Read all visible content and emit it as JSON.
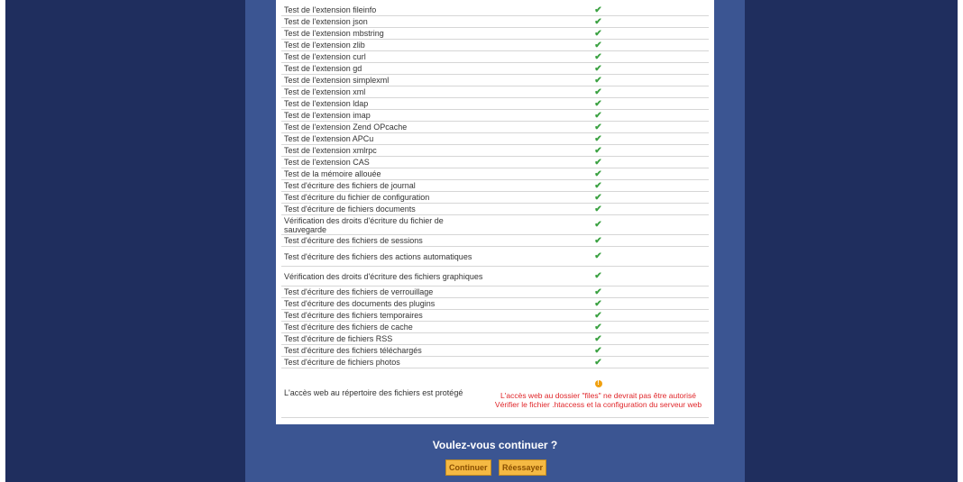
{
  "checks": [
    {
      "label": "Test de l'extension fileinfo",
      "status": "ok"
    },
    {
      "label": "Test de l'extension json",
      "status": "ok"
    },
    {
      "label": "Test de l'extension mbstring",
      "status": "ok"
    },
    {
      "label": "Test de l'extension zlib",
      "status": "ok"
    },
    {
      "label": "Test de l'extension curl",
      "status": "ok"
    },
    {
      "label": "Test de l'extension gd",
      "status": "ok"
    },
    {
      "label": "Test de l'extension simplexml",
      "status": "ok"
    },
    {
      "label": "Test de l'extension xml",
      "status": "ok"
    },
    {
      "label": "Test de l'extension ldap",
      "status": "ok"
    },
    {
      "label": "Test de l'extension imap",
      "status": "ok"
    },
    {
      "label": "Test de l'extension Zend OPcache",
      "status": "ok"
    },
    {
      "label": "Test de l'extension APCu",
      "status": "ok"
    },
    {
      "label": "Test de l'extension xmlrpc",
      "status": "ok"
    },
    {
      "label": "Test de l'extension CAS",
      "status": "ok"
    },
    {
      "label": "Test de la mémoire allouée",
      "status": "ok"
    },
    {
      "label": "Test d'écriture des fichiers de journal",
      "status": "ok"
    },
    {
      "label": "Test d'écriture du fichier de configuration",
      "status": "ok"
    },
    {
      "label": "Test d'écriture de fichiers documents",
      "status": "ok"
    },
    {
      "label": "Vérification des droits d'écriture du fichier de sauvegarde",
      "status": "ok"
    },
    {
      "label": "Test d'écriture des fichiers de sessions",
      "status": "ok"
    },
    {
      "label": "Test d'écriture des fichiers des actions automatiques",
      "status": "ok"
    },
    {
      "label": "Vérification des droits d'écriture des fichiers graphiques",
      "status": "ok"
    },
    {
      "label": "Test d'écriture des fichiers de verrouillage",
      "status": "ok"
    },
    {
      "label": "Test d'écriture des documents des plugins",
      "status": "ok"
    },
    {
      "label": "Test d'écriture des fichiers temporaires",
      "status": "ok"
    },
    {
      "label": "Test d'écriture des fichiers de cache",
      "status": "ok"
    },
    {
      "label": "Test d'écriture de fichiers RSS",
      "status": "ok"
    },
    {
      "label": "Test d'écriture des fichiers téléchargés",
      "status": "ok"
    },
    {
      "label": "Test d'écriture de fichiers photos",
      "status": "ok"
    }
  ],
  "warning_check": {
    "label": "L'accès web au répertoire des fichiers est protégé",
    "icon": "warning-icon",
    "message_line1": "L'accès web au dossier \"files\" ne devrait pas être autorisé",
    "message_line2": "Vérifier le fichier .htaccess et la configuration du serveur web"
  },
  "ok_icon": "check-icon",
  "ok_glyph": "✔",
  "warn_glyph": "!",
  "question": "Voulez-vous continuer ?",
  "buttons": {
    "continue": "Continuer",
    "retry": "Réessayer"
  },
  "colors": {
    "background": "#1f2e5e",
    "panel": "#3b5592",
    "ok": "#3aa141",
    "warning_text": "#e0262a",
    "button": "#f5b943"
  }
}
